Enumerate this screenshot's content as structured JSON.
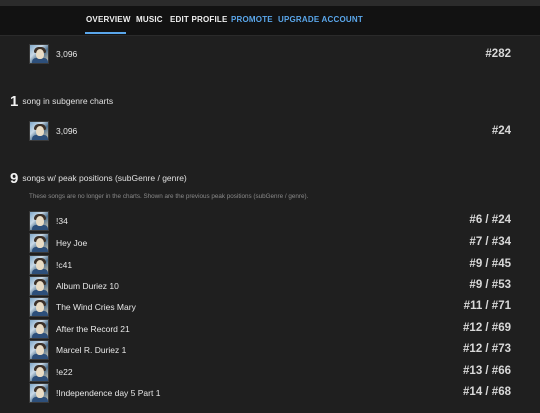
{
  "nav": {
    "items": [
      {
        "label": "OVERVIEW",
        "active": true
      },
      {
        "label": "MUSIC"
      },
      {
        "label": "EDIT PROFILE"
      },
      {
        "label": "PROMOTE"
      },
      {
        "label": "UPGRADE ACCOUNT"
      }
    ],
    "accent_color": "#5aa6ea"
  },
  "top_row": {
    "title": "3,096",
    "rank": "#282"
  },
  "subgenre": {
    "count": "1",
    "label": "song in subgenre charts",
    "row": {
      "title": "3,096",
      "rank": "#24"
    }
  },
  "peaks": {
    "count": "9",
    "label": "songs w/ peak positions (subGenre / genre)",
    "note": "These songs are no longer in the charts. Shown are the previous peak positions (subGenre / genre).",
    "songs": [
      {
        "title": "!34",
        "rank": "#6 / #24"
      },
      {
        "title": "Hey Joe",
        "rank": "#7 / #34"
      },
      {
        "title": "!c41",
        "rank": "#9 / #45"
      },
      {
        "title": "Album Duriez 10",
        "rank": "#9 / #53"
      },
      {
        "title": "The Wind Cries Mary",
        "rank": "#11 / #71"
      },
      {
        "title": "After the Record 21",
        "rank": "#12 / #69"
      },
      {
        "title": "Marcel R. Duriez 1",
        "rank": "#12 / #73"
      },
      {
        "title": "!e22",
        "rank": "#13 / #66"
      },
      {
        "title": "!Independence day 5 Part 1",
        "rank": "#14 / #68"
      }
    ]
  }
}
